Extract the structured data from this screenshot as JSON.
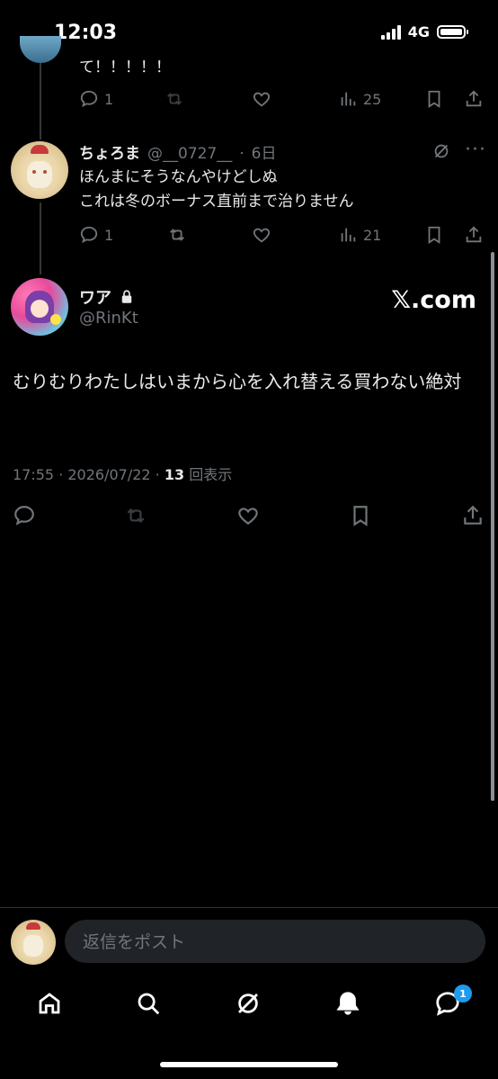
{
  "status_bar": {
    "time": "12:03",
    "network": "4G"
  },
  "thread": {
    "prev_tweet": {
      "text": "て！！！！！",
      "replies": "1",
      "views": "25"
    },
    "reply_tweet": {
      "display_name": "ちょろま",
      "handle": "@__0727__",
      "separator": "·",
      "age": "6日",
      "lines": [
        "ほんまにそうなんやけどしぬ",
        "これは冬のボーナス直前まで治りません"
      ],
      "replies": "1",
      "views": "21"
    }
  },
  "main_tweet": {
    "display_name": "ワア",
    "handle": "@RinKt",
    "brand": "𝕏.com",
    "text": "むりむりわたしはいまから心を入れ替える買わない絶対",
    "meta": "17:55 · 2026/07/22 · ",
    "view_count": "13",
    "view_label": "回表示"
  },
  "composer": {
    "placeholder": "返信をポスト"
  },
  "bottom_nav": {
    "messages_badge": "1"
  }
}
